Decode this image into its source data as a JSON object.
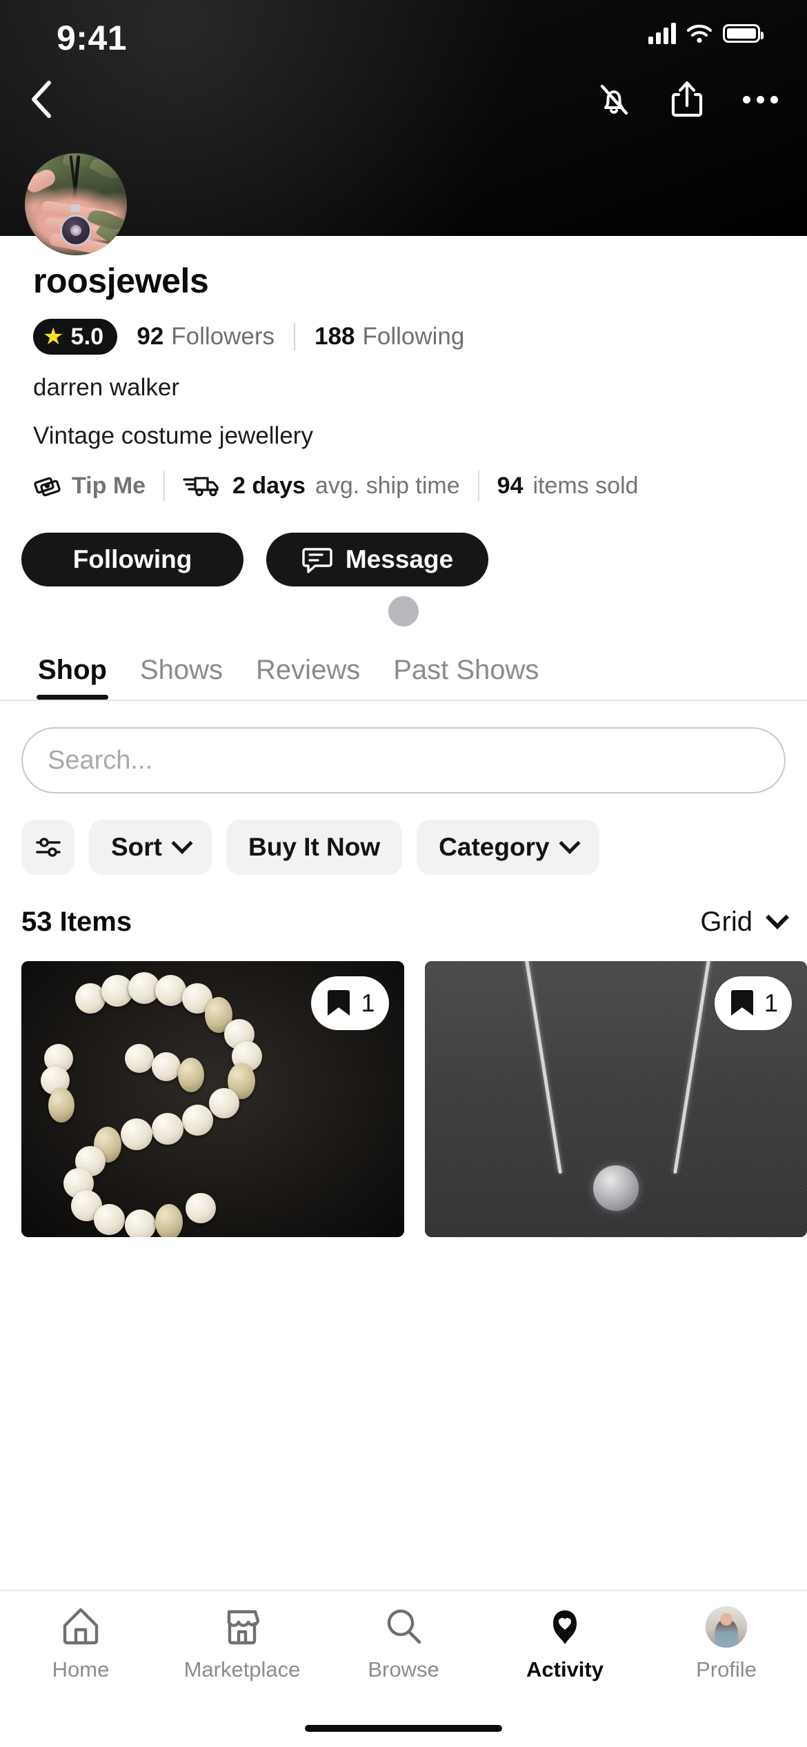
{
  "status_bar": {
    "time": "9:41",
    "signal_icon": "cellular-bars-icon",
    "wifi_icon": "wifi-icon",
    "battery_icon": "battery-full-icon"
  },
  "top_nav": {
    "back_icon": "back-chevron-icon",
    "mute_icon": "bell-off-icon",
    "share_icon": "share-icon",
    "more_icon": "more-horizontal-icon"
  },
  "profile": {
    "avatar_alt": "hand holding pendant necklace over green plants",
    "username": "roosjewels",
    "rating": "5.0",
    "rating_star_color": "#FFE11A",
    "followers_count": "92",
    "followers_label": "Followers",
    "following_count": "188",
    "following_label": "Following",
    "real_name": "darren walker",
    "bio": "Vintage costume jewellery",
    "tip_label": "Tip Me",
    "tip_icon": "money-bills-icon",
    "ship_icon": "delivery-truck-icon",
    "ship_time_value": "2 days",
    "ship_time_label": "avg. ship time",
    "items_sold_count": "94",
    "items_sold_label": "items sold",
    "follow_button": "Following",
    "message_button": "Message",
    "message_icon": "chat-bubble-icon"
  },
  "tabs": [
    {
      "label": "Shop",
      "active": true
    },
    {
      "label": "Shows",
      "active": false
    },
    {
      "label": "Reviews",
      "active": false
    },
    {
      "label": "Past Shows",
      "active": false
    }
  ],
  "search": {
    "placeholder": "Search...",
    "value": ""
  },
  "filters": {
    "filter_icon": "sliders-icon",
    "chips": [
      {
        "label": "Sort",
        "has_chevron": true
      },
      {
        "label": "Buy It Now",
        "has_chevron": false
      },
      {
        "label": "Category",
        "has_chevron": true
      }
    ]
  },
  "listing_header": {
    "items_count": "53 Items",
    "view_mode": "Grid",
    "view_chevron_icon": "chevron-down-icon"
  },
  "products": [
    {
      "alt": "white and gold beaded vintage necklace on dark background",
      "save_icon": "bookmark-icon",
      "save_count": "1"
    },
    {
      "alt": "silver chain necklace with round pendant on grey fabric",
      "save_icon": "bookmark-icon",
      "save_count": "1"
    }
  ],
  "bottom_nav": [
    {
      "label": "Home",
      "icon": "home-icon",
      "active": false
    },
    {
      "label": "Marketplace",
      "icon": "storefront-icon",
      "active": false
    },
    {
      "label": "Browse",
      "icon": "search-icon",
      "active": false
    },
    {
      "label": "Activity",
      "icon": "heart-pin-icon",
      "active": true
    },
    {
      "label": "Profile",
      "icon": "user-avatar-icon",
      "active": false
    }
  ]
}
